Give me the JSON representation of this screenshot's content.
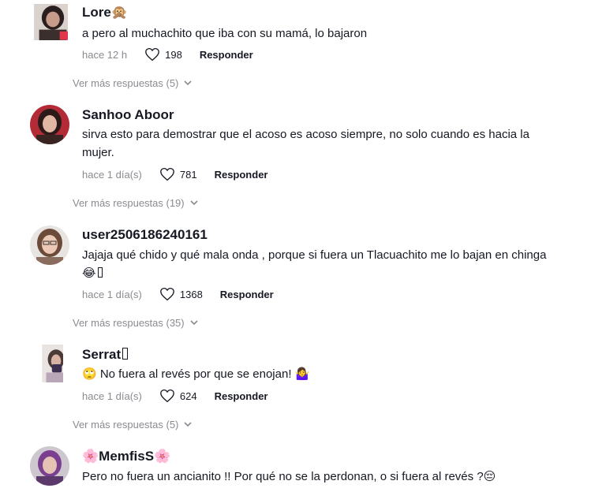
{
  "comments": [
    {
      "username": "Lore🙊",
      "text": "a pero al muchachito que iba con su mamá, lo bajaron",
      "time": "hace 12 h",
      "likes": "198",
      "reply": "Responder",
      "more": "Ver más respuestas (5)"
    },
    {
      "username": "Sanhoo Aboor",
      "text": "sirva esto para demostrar que el acoso es acoso siempre, no solo cuando es hacia la mujer.",
      "time": "hace 1 día(s)",
      "likes": "781",
      "reply": "Responder",
      "more": "Ver más respuestas (19)"
    },
    {
      "username": "user2506186240161",
      "text": "Jajaja qué chido y qué mala onda , porque si fuera un Tlacuachito me lo bajan en chinga 😂",
      "time": "hace 1 día(s)",
      "likes": "1368",
      "reply": "Responder",
      "more": "Ver más respuestas (35)"
    },
    {
      "username": "Serrat",
      "text": "🙄 No fuera al revés por que se enojan! 🤷‍♀️",
      "time": "hace 1 día(s)",
      "likes": "624",
      "reply": "Responder",
      "more": "Ver más respuestas (5)"
    },
    {
      "username": "🌸MemfisS🌸",
      "text": "Pero no fuera un ancianito !! Por qué no se la perdonan, o si fuera al revés ?😔"
    }
  ],
  "colors": {
    "text": "#161823",
    "muted": "#8a8b91",
    "background": "#ffffff"
  },
  "icons": {
    "like": "heart-outline-icon",
    "expand": "chevron-down-icon"
  }
}
